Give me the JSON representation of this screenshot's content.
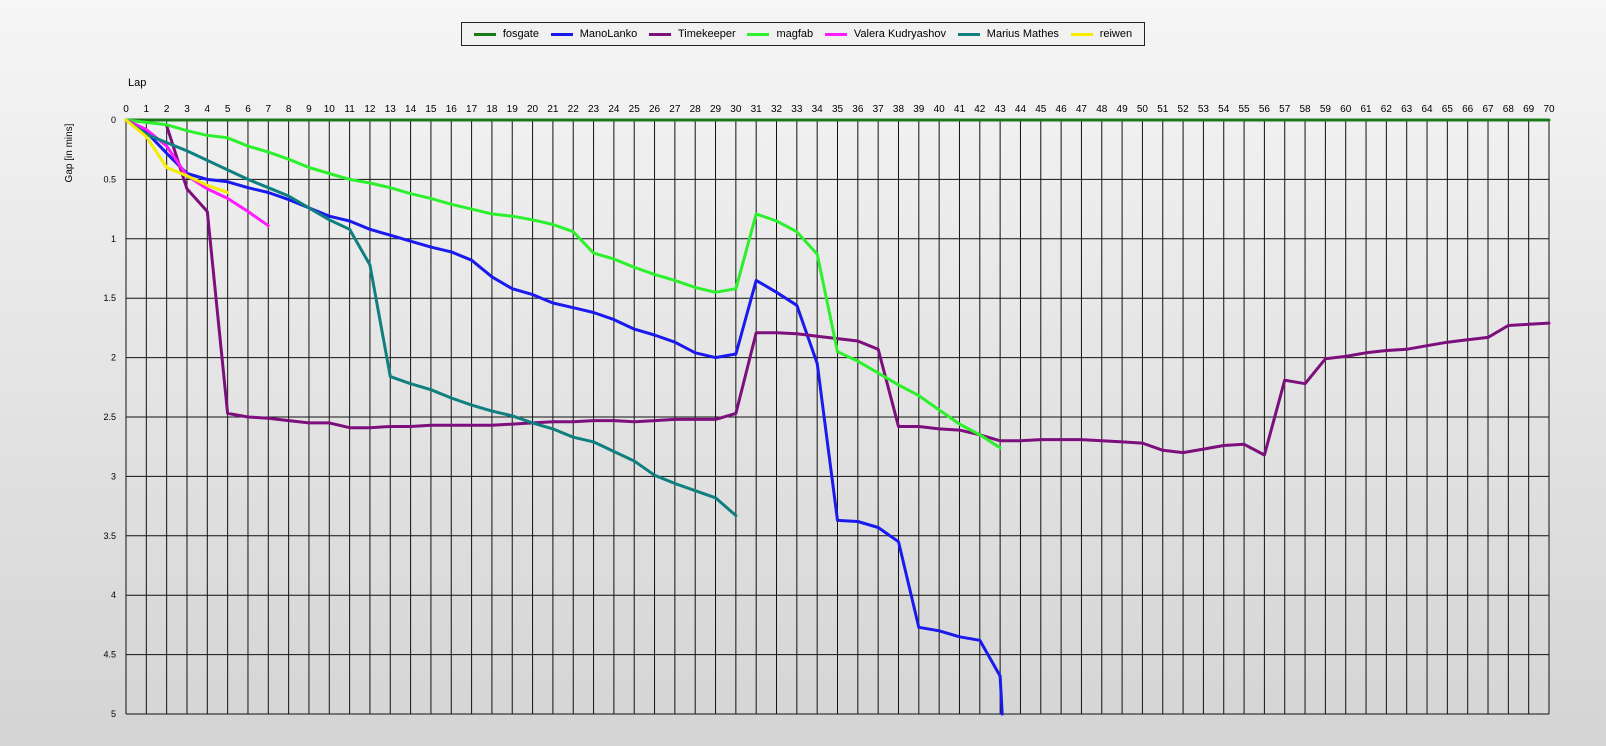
{
  "chart_data": {
    "type": "line",
    "xlabel": "Lap",
    "ylabel": "Gap [in mins]",
    "xlim": [
      0,
      70
    ],
    "ylim": [
      0,
      5
    ],
    "y_inverted": true,
    "x_ticks": [
      0,
      1,
      2,
      3,
      4,
      5,
      6,
      7,
      8,
      9,
      10,
      11,
      12,
      13,
      14,
      15,
      16,
      17,
      18,
      19,
      20,
      21,
      22,
      23,
      24,
      25,
      26,
      27,
      28,
      29,
      30,
      31,
      32,
      33,
      34,
      35,
      36,
      37,
      38,
      39,
      40,
      41,
      42,
      43,
      44,
      45,
      46,
      47,
      48,
      49,
      50,
      51,
      52,
      53,
      54,
      55,
      56,
      57,
      58,
      59,
      60,
      61,
      62,
      63,
      64,
      65,
      66,
      67,
      68,
      69,
      70
    ],
    "y_ticks": [
      "0",
      "0.5",
      "1",
      "1.5",
      "2",
      "2.5",
      "3",
      "3.5",
      "4",
      "4.5",
      "5"
    ],
    "grid": true,
    "legend_position": "top-center",
    "series": [
      {
        "name": "fosgate",
        "color": "#1a7a1a",
        "x": [
          0,
          70
        ],
        "y": [
          0,
          0
        ]
      },
      {
        "name": "ManoLanko",
        "color": "#1a1aee",
        "x": [
          0,
          1,
          2,
          3,
          4,
          5,
          6,
          7,
          8,
          9,
          10,
          11,
          12,
          13,
          14,
          15,
          16,
          17,
          18,
          19,
          20,
          21,
          22,
          23,
          24,
          25,
          26,
          27,
          28,
          29,
          30,
          31,
          32,
          33,
          34,
          35,
          36,
          37,
          38,
          39,
          40,
          41,
          42,
          43,
          43.1
        ],
        "y": [
          0,
          0.1,
          0.28,
          0.45,
          0.5,
          0.52,
          0.57,
          0.61,
          0.67,
          0.74,
          0.81,
          0.85,
          0.92,
          0.97,
          1.02,
          1.07,
          1.11,
          1.18,
          1.32,
          1.42,
          1.47,
          1.54,
          1.58,
          1.62,
          1.68,
          1.76,
          1.81,
          1.87,
          1.96,
          2.0,
          1.97,
          1.35,
          1.45,
          1.56,
          2.05,
          3.37,
          3.38,
          3.43,
          3.55,
          4.27,
          4.3,
          4.35,
          4.38,
          4.68,
          5.0
        ]
      },
      {
        "name": "Timekeeper",
        "color": "#7d0f7d",
        "x": [
          2,
          3,
          4,
          5,
          6,
          7,
          8,
          9,
          10,
          11,
          12,
          13,
          14,
          15,
          16,
          17,
          18,
          19,
          20,
          21,
          22,
          23,
          24,
          25,
          26,
          27,
          28,
          29,
          30,
          31,
          32,
          33,
          34,
          35,
          36,
          37,
          38,
          39,
          40,
          41,
          42,
          43,
          44,
          45,
          46,
          47,
          48,
          49,
          50,
          51,
          52,
          53,
          54,
          55,
          56,
          57,
          58,
          59,
          60,
          61,
          62,
          63,
          64,
          65,
          66,
          67,
          68,
          69,
          70
        ],
        "y": [
          0.05,
          0.58,
          0.77,
          2.47,
          2.5,
          2.51,
          2.53,
          2.55,
          2.55,
          2.59,
          2.59,
          2.58,
          2.58,
          2.57,
          2.57,
          2.57,
          2.57,
          2.56,
          2.55,
          2.54,
          2.54,
          2.53,
          2.53,
          2.54,
          2.53,
          2.52,
          2.52,
          2.52,
          2.47,
          1.79,
          1.79,
          1.8,
          1.82,
          1.84,
          1.86,
          1.93,
          2.58,
          2.58,
          2.6,
          2.61,
          2.65,
          2.7,
          2.7,
          2.69,
          2.69,
          2.69,
          2.7,
          2.71,
          2.72,
          2.78,
          2.8,
          2.77,
          2.74,
          2.73,
          2.82,
          2.19,
          2.22,
          2.01,
          1.99,
          1.96,
          1.94,
          1.93,
          1.9,
          1.87,
          1.85,
          1.83,
          1.73,
          1.72,
          1.71
        ]
      },
      {
        "name": "magfab",
        "color": "#2cf02c",
        "x": [
          0,
          1,
          2,
          3,
          4,
          5,
          6,
          7,
          8,
          9,
          10,
          11,
          12,
          13,
          14,
          15,
          16,
          17,
          18,
          19,
          20,
          21,
          22,
          23,
          24,
          25,
          26,
          27,
          28,
          29,
          30,
          31,
          32,
          33,
          34,
          35,
          36,
          37,
          38,
          39,
          40,
          41,
          42,
          43
        ],
        "y": [
          0,
          0.02,
          0.04,
          0.09,
          0.13,
          0.15,
          0.22,
          0.27,
          0.33,
          0.4,
          0.45,
          0.5,
          0.53,
          0.57,
          0.62,
          0.66,
          0.71,
          0.75,
          0.79,
          0.81,
          0.84,
          0.88,
          0.94,
          1.12,
          1.17,
          1.24,
          1.3,
          1.35,
          1.41,
          1.45,
          1.42,
          0.79,
          0.85,
          0.94,
          1.13,
          1.95,
          2.03,
          2.13,
          2.23,
          2.32,
          2.44,
          2.56,
          2.65,
          2.76
        ]
      },
      {
        "name": "Valera Kudryashov",
        "color": "#ff1aff",
        "x": [
          0,
          1,
          2,
          3,
          4,
          5,
          6,
          7
        ],
        "y": [
          0,
          0.08,
          0.22,
          0.47,
          0.58,
          0.66,
          0.77,
          0.89
        ]
      },
      {
        "name": "Marius Mathes",
        "color": "#0f7f7f",
        "x": [
          0,
          1,
          2,
          3,
          4,
          5,
          6,
          7,
          8,
          9,
          10,
          11,
          12,
          13,
          14,
          15,
          16,
          17,
          18,
          19,
          20,
          21,
          22,
          23,
          24,
          25,
          26,
          27,
          28,
          29,
          30
        ],
        "y": [
          0,
          0.12,
          0.19,
          0.26,
          0.34,
          0.42,
          0.5,
          0.57,
          0.64,
          0.74,
          0.84,
          0.92,
          1.22,
          2.16,
          2.22,
          2.27,
          2.34,
          2.4,
          2.45,
          2.49,
          2.55,
          2.6,
          2.67,
          2.71,
          2.79,
          2.87,
          2.99,
          3.06,
          3.12,
          3.18,
          3.33
        ]
      },
      {
        "name": "reiwen",
        "color": "#f5ec00",
        "x": [
          0,
          1,
          2,
          3,
          4,
          5
        ],
        "y": [
          0,
          0.14,
          0.4,
          0.47,
          0.55,
          0.61
        ]
      }
    ]
  }
}
